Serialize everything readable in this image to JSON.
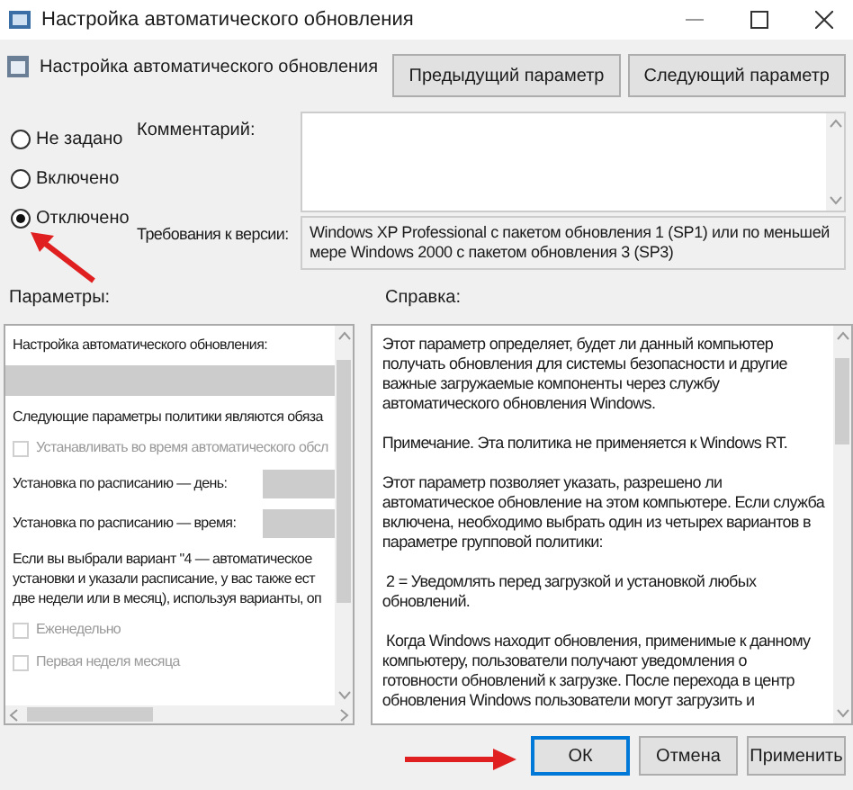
{
  "window": {
    "title": "Настройка автоматического обновления"
  },
  "header": {
    "title": "Настройка автоматического обновления"
  },
  "nav_buttons": [
    {
      "label": "Предыдущий параметр"
    },
    {
      "label": "Следующий параметр"
    }
  ],
  "options": [
    {
      "label": "Не задано",
      "selected": false
    },
    {
      "label": "Включено",
      "selected": false
    },
    {
      "label": "Отключено",
      "selected": true
    }
  ],
  "comment": {
    "label": "Комментарий:"
  },
  "requirements": {
    "label": "Требования к версии:",
    "lines": [
      "Windows XP Professional с пакетом обновления 1 (SP1) или по меньшей",
      "мере Windows 2000 с пакетом обновления 3 (SP3)"
    ]
  },
  "parameters": {
    "label": "Параметры:",
    "items": [
      {
        "kind": "text",
        "lines": [
          "Настройка автоматического обновления:"
        ]
      },
      {
        "kind": "dropdown"
      },
      {
        "kind": "text",
        "lines": [
          "Следующие параметры политики являются обяза"
        ]
      },
      {
        "kind": "checkbox",
        "label": "Устанавливать во время автоматического обсл",
        "checked": false,
        "disabled": true
      },
      {
        "kind": "labeled_dropdown",
        "label": "Установка по расписанию — день:"
      },
      {
        "kind": "labeled_dropdown",
        "label": "Установка по расписанию — время:"
      },
      {
        "kind": "text",
        "lines": [
          "Если вы выбрали вариант \"4 — автоматическое",
          "установки и указали расписание, у вас также ест",
          "две недели или в месяц), используя варианты, оп"
        ]
      },
      {
        "kind": "checkbox",
        "label": "Еженедельно",
        "checked": false,
        "disabled": true
      },
      {
        "kind": "checkbox",
        "label": "Первая неделя месяца",
        "checked": false,
        "disabled": true
      }
    ]
  },
  "help": {
    "label": "Справка:",
    "paragraphs": [
      [
        "Этот параметр определяет, будет ли данный компьютер",
        "получать обновления для системы безопасности и другие",
        "важные загружаемые компоненты через службу",
        "автоматического обновления Windows."
      ],
      [
        "Примечание. Эта политика не применяется к Windows RT."
      ],
      [
        "Этот параметр позволяет указать, разрешено ли",
        "автоматическое обновление на этом компьютере. Если служба",
        "включена, необходимо выбрать один из четырех вариантов в",
        "параметре групповой политики:"
      ],
      [
        " 2 = Уведомлять перед загрузкой и установкой любых",
        "обновлений."
      ],
      [
        " Когда Windows находит обновления, применимые к данному",
        "компьютеру, пользователи получают уведомления о",
        "готовности обновлений к загрузке. После перехода в центр",
        "обновления Windows пользователи могут загрузить и"
      ]
    ]
  },
  "buttons": [
    {
      "label": "ОК",
      "default": true
    },
    {
      "label": "Отмена",
      "default": false
    },
    {
      "label": "Применить",
      "default": false
    }
  ]
}
